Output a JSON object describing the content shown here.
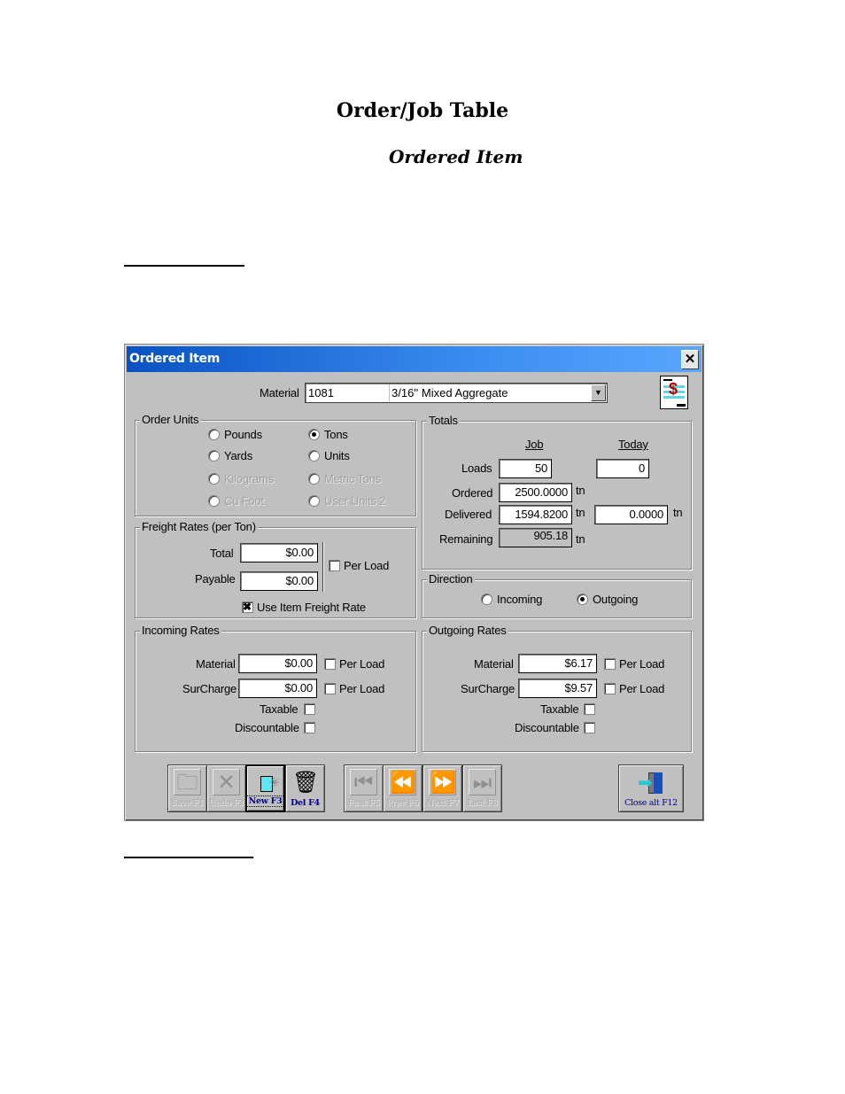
{
  "document": {
    "title": "Order/Job Table",
    "subtitle": "Ordered Item"
  },
  "dialog": {
    "title": "Ordered Item",
    "close_label": "✕",
    "material": {
      "label": "Material",
      "code": "1081",
      "description": "3/16''  Mixed  Aggregate",
      "dropdown_glyph": "▼"
    },
    "report_icon_glyph": "$",
    "order_units": {
      "title": "Order Units",
      "options": [
        {
          "label": "Pounds",
          "selected": false,
          "enabled": true
        },
        {
          "label": "Tons",
          "selected": true,
          "enabled": true
        },
        {
          "label": "Yards",
          "selected": false,
          "enabled": true
        },
        {
          "label": "Units",
          "selected": false,
          "enabled": true
        },
        {
          "label": "Kilograms",
          "selected": false,
          "enabled": false
        },
        {
          "label": "Metric Tons",
          "selected": false,
          "enabled": false
        },
        {
          "label": "Cu Foot",
          "selected": false,
          "enabled": false
        },
        {
          "label": "User Units 2",
          "selected": false,
          "enabled": false
        }
      ]
    },
    "totals": {
      "title": "Totals",
      "col_job": "Job",
      "col_today": "Today",
      "unit": "tn",
      "loads_label": "Loads",
      "loads_job": "50",
      "loads_today": "0",
      "ordered_label": "Ordered",
      "ordered_job": "2500.0000",
      "delivered_label": "Delivered",
      "delivered_job": "1594.8200",
      "delivered_today": "0.0000",
      "remaining_label": "Remaining",
      "remaining_job": "905.18"
    },
    "freight": {
      "title": "Freight Rates (per Ton)",
      "total_label": "Total",
      "total_value": "$0.00",
      "payable_label": "Payable",
      "payable_value": "$0.00",
      "per_load_label": "Per Load",
      "per_load_checked": false,
      "use_item_label": "Use Item Freight Rate",
      "use_item_checked": true
    },
    "direction": {
      "title": "Direction",
      "incoming_label": "Incoming",
      "outgoing_label": "Outgoing",
      "selected": "Outgoing"
    },
    "incoming_rates": {
      "title": "Incoming Rates",
      "material_label": "Material",
      "material_value": "$0.00",
      "surcharge_label": "SurCharge",
      "surcharge_value": "$0.00",
      "per_load_label": "Per Load",
      "taxable_label": "Taxable",
      "discountable_label": "Discountable"
    },
    "outgoing_rates": {
      "title": "Outgoing Rates",
      "material_label": "Material",
      "material_value": "$6.17",
      "surcharge_label": "SurCharge",
      "surcharge_value": "$9.57",
      "per_load_label": "Per Load",
      "taxable_label": "Taxable",
      "discountable_label": "Discountable"
    },
    "toolbar": {
      "save": "Save F1",
      "undo": "Undo F2",
      "new": "New F3",
      "delete": "Del F4",
      "first": "First F5",
      "prev": "Prev F6",
      "next": "Next F7",
      "last": "Last F8",
      "close": "Close alt F12"
    }
  }
}
